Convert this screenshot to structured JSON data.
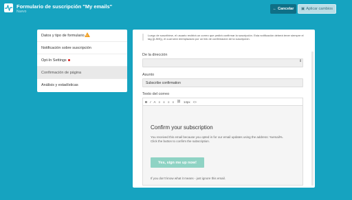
{
  "header": {
    "title": "Formulario de suscripción \"My emails\"",
    "subtitle": "Nuevo",
    "cancel_label": "Cancelar",
    "apply_label": "Aplicar cambios"
  },
  "sidebar": {
    "items": [
      {
        "label": "Datos y tipo de formulario"
      },
      {
        "label": "Notificación sobre suscripción"
      },
      {
        "label": "Opt-In Settings"
      },
      {
        "label": "Confirmación de página"
      },
      {
        "label": "Análisis y estadísticas"
      }
    ]
  },
  "panel": {
    "info_text": "Luego de suscribirse, el usuario recibirá un correo que pedirá confirmar la suscripción. Esta notificación deberá tener siempre el tag {{LINK}}, el cual será reemplazado por un link de confirmación de la suscripción.",
    "from_label": "De la dirección",
    "subject_label": "Asunto",
    "subject_value": "Subscribe confirmation",
    "body_label": "Texto del correo",
    "toolbar": {
      "bold": "B",
      "italic": "I",
      "text_color": "A",
      "font_size": "14px",
      "source": "<>"
    },
    "email": {
      "title": "Confirm your subscription",
      "body_line1": "You received this email because you opted in for our email updates using the address: %email%.",
      "body_line2": "Click the button to confirm the subscription.",
      "button_label": "Yes, sign me up now!",
      "footer": "If you don't know what it means - just ignore this email."
    }
  },
  "colors": {
    "background": "#16a3c0",
    "cancel_button": "#0f6f86",
    "apply_button": "#b9dde6",
    "email_button": "#8fd3c4",
    "warning": "#f1a022",
    "badge": "#e02b2b"
  }
}
